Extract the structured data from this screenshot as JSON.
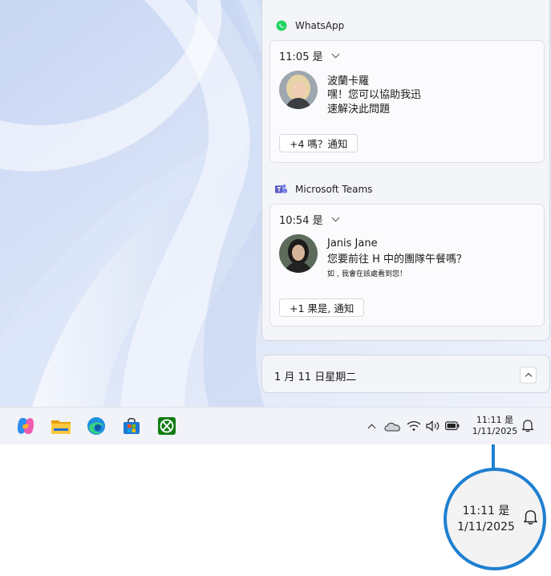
{
  "notifications": [
    {
      "app_name": "WhatsApp",
      "app_icon": "whatsapp-icon",
      "time": "11:05 是",
      "sender": "波蘭卡羅",
      "message_line1": "嘿！您可以協助我迅",
      "message_line2": "速解決此問題",
      "more_label": "+4 嗎？通知"
    },
    {
      "app_name": "Microsoft Teams",
      "app_icon": "teams-icon",
      "time": "10:54 是",
      "sender": "Janis Jane",
      "message_line1": "您要前往 H 中的團隊午餐嗎？",
      "message_line2": "如﹐我會在該處看到您！",
      "more_label": "+1 果是, 通知"
    }
  ],
  "calendar": {
    "date_label": "1 月 11 日星期二"
  },
  "taskbar": {
    "apps": [
      "copilot-icon",
      "file-explorer-icon",
      "edge-icon",
      "store-icon",
      "xbox-icon"
    ],
    "tray": [
      "chevron-up-icon",
      "onedrive-icon",
      "wifi-icon",
      "volume-icon",
      "battery-icon"
    ],
    "clock_time": "11:11 是",
    "clock_date": "1/11/2025"
  },
  "magnifier": {
    "clock_time": "11:11 是",
    "clock_date": "1/11/2025"
  },
  "colors": {
    "accent": "#1e7fd1",
    "whatsapp": "#25d366",
    "teams": "#5b5fc7"
  }
}
